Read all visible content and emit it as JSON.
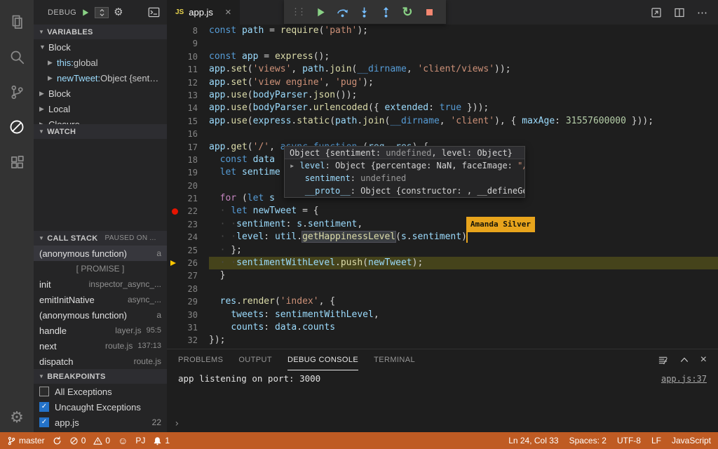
{
  "colors": {
    "status-bg": "#BF5B23",
    "flag": "#E8A41C",
    "breakpoint": "#E51400",
    "exec-line": "#45431B",
    "kw": "#569CD6",
    "ct": "#C586C0",
    "st": "#CE9178",
    "fn": "#DCDCAA",
    "vr": "#9CDCFE",
    "nm": "#B5CEA8"
  },
  "activity_bar": {
    "items": [
      {
        "name": "explorer"
      },
      {
        "name": "search"
      },
      {
        "name": "source-control"
      },
      {
        "name": "debug",
        "active": true
      },
      {
        "name": "extensions"
      }
    ]
  },
  "sidebar": {
    "toolbar": {
      "title": "DEBUG"
    },
    "variables": {
      "title": "VARIABLES",
      "rows": [
        {
          "label": "Block",
          "depth": 0,
          "expanded": true
        },
        {
          "name": "this",
          "value": "global",
          "depth": 1
        },
        {
          "name": "newTweet",
          "value": "Object {sent…",
          "depth": 1
        },
        {
          "label": "Block",
          "depth": 0
        },
        {
          "label": "Local",
          "depth": 0
        },
        {
          "label": "Closure",
          "depth": 0
        }
      ]
    },
    "watch": {
      "title": "WATCH"
    },
    "call_stack": {
      "title": "CALL STACK",
      "status": "PAUSED ON ...",
      "rows": [
        {
          "name": "(anonymous function)",
          "file": "a",
          "selected": true
        },
        {
          "separator": "[ PROMISE ]"
        },
        {
          "name": "init",
          "file": "inspector_async_..."
        },
        {
          "name": "emitInitNative",
          "file": "async_..."
        },
        {
          "name": "(anonymous function)",
          "file": "a"
        },
        {
          "name": "handle",
          "file": "layer.js",
          "pos": "95:5"
        },
        {
          "name": "next",
          "file": "route.js",
          "pos": "137:13"
        },
        {
          "name": "dispatch",
          "file": "route.js"
        }
      ]
    },
    "breakpoints": {
      "title": "BREAKPOINTS",
      "rows": [
        {
          "checked": false,
          "label": "All Exceptions"
        },
        {
          "checked": true,
          "label": "Uncaught Exceptions"
        },
        {
          "checked": true,
          "label": "app.js",
          "line": "22"
        }
      ]
    }
  },
  "tabbar": {
    "tab": {
      "icon": "JS",
      "title": "app.js"
    }
  },
  "debug_toolbar": {
    "buttons": [
      "continue",
      "step-over",
      "step-into",
      "step-out",
      "restart",
      "stop"
    ]
  },
  "editor": {
    "collaborator": "Amanda Silver",
    "tooltip": {
      "rows": [
        [
          [
            "pl",
            "Object {sentiment: "
          ],
          [
            "und",
            "undefined"
          ],
          [
            "pl",
            ", level: Object}"
          ]
        ],
        [
          [
            "tw",
            "▸ "
          ],
          [
            "vr",
            "level"
          ],
          [
            "pl",
            ": Object {percentage: NaN, faceImage: "
          ],
          [
            "st",
            "\"/a"
          ]
        ],
        [
          [
            "pl",
            "   "
          ],
          [
            "vr",
            "sentiment"
          ],
          [
            "pl",
            ": "
          ],
          [
            "und",
            "undefined"
          ]
        ],
        [
          [
            "pl",
            "   "
          ],
          [
            "vr",
            "__proto__"
          ],
          [
            "pl",
            ": Object {constructor: , __defineGette"
          ]
        ]
      ]
    },
    "lines": [
      {
        "n": 8,
        "t": [
          [
            "kw",
            "const"
          ],
          [
            "pl",
            " "
          ],
          [
            "vr",
            "path"
          ],
          [
            "pl",
            " = "
          ],
          [
            "fn",
            "require"
          ],
          [
            "pl",
            "("
          ],
          [
            "st",
            "'path'"
          ],
          [
            "pl",
            ");"
          ]
        ]
      },
      {
        "n": 9,
        "t": []
      },
      {
        "n": 10,
        "t": [
          [
            "kw",
            "const"
          ],
          [
            "pl",
            " "
          ],
          [
            "vr",
            "app"
          ],
          [
            "pl",
            " = "
          ],
          [
            "fn",
            "express"
          ],
          [
            "pl",
            "();"
          ]
        ]
      },
      {
        "n": 11,
        "t": [
          [
            "vr",
            "app"
          ],
          [
            "pl",
            "."
          ],
          [
            "fn",
            "set"
          ],
          [
            "pl",
            "("
          ],
          [
            "st",
            "'views'"
          ],
          [
            "pl",
            ", "
          ],
          [
            "vr",
            "path"
          ],
          [
            "pl",
            "."
          ],
          [
            "fn",
            "join"
          ],
          [
            "pl",
            "("
          ],
          [
            "kw",
            "__dirname"
          ],
          [
            "pl",
            ", "
          ],
          [
            "st",
            "'client/views'"
          ],
          [
            "pl",
            "));"
          ]
        ]
      },
      {
        "n": 12,
        "t": [
          [
            "vr",
            "app"
          ],
          [
            "pl",
            "."
          ],
          [
            "fn",
            "set"
          ],
          [
            "pl",
            "("
          ],
          [
            "st",
            "'view engine'"
          ],
          [
            "pl",
            ", "
          ],
          [
            "st",
            "'pug'"
          ],
          [
            "pl",
            ");"
          ]
        ]
      },
      {
        "n": 13,
        "t": [
          [
            "vr",
            "app"
          ],
          [
            "pl",
            "."
          ],
          [
            "fn",
            "use"
          ],
          [
            "pl",
            "("
          ],
          [
            "vr",
            "bodyParser"
          ],
          [
            "pl",
            "."
          ],
          [
            "fn",
            "json"
          ],
          [
            "pl",
            "());"
          ]
        ]
      },
      {
        "n": 14,
        "t": [
          [
            "vr",
            "app"
          ],
          [
            "pl",
            "."
          ],
          [
            "fn",
            "use"
          ],
          [
            "pl",
            "("
          ],
          [
            "vr",
            "bodyParser"
          ],
          [
            "pl",
            "."
          ],
          [
            "fn",
            "urlencoded"
          ],
          [
            "pl",
            "({ "
          ],
          [
            "vr",
            "extended"
          ],
          [
            "pl",
            ": "
          ],
          [
            "kw",
            "true"
          ],
          [
            "pl",
            " }));"
          ]
        ]
      },
      {
        "n": 15,
        "t": [
          [
            "vr",
            "app"
          ],
          [
            "pl",
            "."
          ],
          [
            "fn",
            "use"
          ],
          [
            "pl",
            "("
          ],
          [
            "vr",
            "express"
          ],
          [
            "pl",
            "."
          ],
          [
            "fn",
            "static"
          ],
          [
            "pl",
            "("
          ],
          [
            "vr",
            "path"
          ],
          [
            "pl",
            "."
          ],
          [
            "fn",
            "join"
          ],
          [
            "pl",
            "("
          ],
          [
            "kw",
            "__dirname"
          ],
          [
            "pl",
            ", "
          ],
          [
            "st",
            "'client'"
          ],
          [
            "pl",
            "), { "
          ],
          [
            "vr",
            "maxAge"
          ],
          [
            "pl",
            ": "
          ],
          [
            "nm",
            "31557600000"
          ],
          [
            "pl",
            " }));"
          ]
        ]
      },
      {
        "n": 16,
        "t": []
      },
      {
        "n": 17,
        "t": [
          [
            "vr",
            "app"
          ],
          [
            "pl",
            "."
          ],
          [
            "fn",
            "get"
          ],
          [
            "pl",
            "("
          ],
          [
            "st",
            "'/'"
          ],
          [
            "pl",
            ", "
          ],
          [
            "kw",
            "async"
          ],
          [
            "pl",
            " "
          ],
          [
            "kw",
            "function"
          ],
          [
            "pl",
            " ("
          ],
          [
            "vr",
            "req"
          ],
          [
            "pl",
            ", "
          ],
          [
            "vr",
            "res"
          ],
          [
            "pl",
            ") {"
          ]
        ]
      },
      {
        "n": 18,
        "t": [
          [
            "pl",
            "  "
          ],
          [
            "kw",
            "const"
          ],
          [
            "pl",
            " "
          ],
          [
            "vr",
            "data"
          ]
        ]
      },
      {
        "n": 19,
        "t": [
          [
            "pl",
            "  "
          ],
          [
            "kw",
            "let"
          ],
          [
            "pl",
            " "
          ],
          [
            "vr",
            "sentime"
          ]
        ]
      },
      {
        "n": 20,
        "t": []
      },
      {
        "n": 21,
        "t": [
          [
            "pl",
            "  "
          ],
          [
            "ct",
            "for"
          ],
          [
            "pl",
            " ("
          ],
          [
            "kw",
            "let"
          ],
          [
            "pl",
            " "
          ],
          [
            "vr",
            "s"
          ]
        ]
      },
      {
        "n": 22,
        "bp": true,
        "t": [
          [
            "ws",
            "  · "
          ],
          [
            "kw",
            "let"
          ],
          [
            "pl",
            " "
          ],
          [
            "vr",
            "newTweet"
          ],
          [
            "pl",
            " = {"
          ]
        ]
      },
      {
        "n": 23,
        "t": [
          [
            "ws",
            "  · ·"
          ],
          [
            "vr",
            "sentiment"
          ],
          [
            "pl",
            ": "
          ],
          [
            "vr",
            "s"
          ],
          [
            "pl",
            "."
          ],
          [
            "vr",
            "sentiment"
          ],
          [
            "pl",
            ","
          ]
        ]
      },
      {
        "n": 24,
        "t": [
          [
            "ws",
            "  · ·"
          ],
          [
            "vr",
            "level"
          ],
          [
            "pl",
            ": "
          ],
          [
            "vr",
            "util"
          ],
          [
            "pl",
            "."
          ],
          [
            "hl",
            "getHappinessLevel"
          ],
          [
            "pl",
            "("
          ],
          [
            "vr",
            "s"
          ],
          [
            "pl",
            "."
          ],
          [
            "vr",
            "sentiment"
          ],
          [
            "pl",
            ")"
          ],
          [
            "cur",
            ""
          ]
        ]
      },
      {
        "n": 25,
        "t": [
          [
            "ws",
            "  · "
          ],
          [
            "pl",
            "};"
          ]
        ]
      },
      {
        "n": 26,
        "exec": true,
        "t": [
          [
            "ws",
            "  · ·"
          ],
          [
            "vr",
            "sentimentWithLevel"
          ],
          [
            "pl",
            "."
          ],
          [
            "fn",
            "push"
          ],
          [
            "pl",
            "("
          ],
          [
            "vr",
            "newTweet"
          ],
          [
            "pl",
            ");"
          ]
        ]
      },
      {
        "n": 27,
        "t": [
          [
            "pl",
            "  }"
          ]
        ]
      },
      {
        "n": 28,
        "t": []
      },
      {
        "n": 29,
        "t": [
          [
            "pl",
            "  "
          ],
          [
            "vr",
            "res"
          ],
          [
            "pl",
            "."
          ],
          [
            "fn",
            "render"
          ],
          [
            "pl",
            "("
          ],
          [
            "st",
            "'index'"
          ],
          [
            "pl",
            ", {"
          ]
        ]
      },
      {
        "n": 30,
        "t": [
          [
            "pl",
            "    "
          ],
          [
            "vr",
            "tweets"
          ],
          [
            "pl",
            ": "
          ],
          [
            "vr",
            "sentimentWithLevel"
          ],
          [
            "pl",
            ","
          ]
        ]
      },
      {
        "n": 31,
        "t": [
          [
            "pl",
            "    "
          ],
          [
            "vr",
            "counts"
          ],
          [
            "pl",
            ": "
          ],
          [
            "vr",
            "data"
          ],
          [
            "pl",
            "."
          ],
          [
            "vr",
            "counts"
          ]
        ]
      },
      {
        "n": 32,
        "t": [
          [
            "pl",
            "});"
          ]
        ]
      }
    ]
  },
  "panel": {
    "tabs": [
      {
        "label": "PROBLEMS"
      },
      {
        "label": "OUTPUT"
      },
      {
        "label": "DEBUG CONSOLE",
        "active": true
      },
      {
        "label": "TERMINAL"
      }
    ],
    "console_line": {
      "text": "app listening on port: 3000",
      "source": "app.js:37"
    },
    "prompt": "›"
  },
  "statusbar": {
    "left": [
      {
        "name": "git-branch",
        "icon": "branch",
        "label": "master"
      },
      {
        "name": "sync",
        "icon": "sync"
      },
      {
        "name": "errors",
        "icon": "error",
        "label": "0"
      },
      {
        "name": "warnings",
        "icon": "warning",
        "label": "0"
      },
      {
        "name": "feedback-smiley",
        "icon": "smiley"
      },
      {
        "name": "live-share-user",
        "label": "PJ"
      },
      {
        "name": "notifications",
        "icon": "bell",
        "label": "1"
      }
    ],
    "right": [
      {
        "name": "cursor-position",
        "label": "Ln 24, Col 33"
      },
      {
        "name": "indentation",
        "label": "Spaces: 2"
      },
      {
        "name": "encoding",
        "label": "UTF-8"
      },
      {
        "name": "eol",
        "label": "LF"
      },
      {
        "name": "language-mode",
        "label": "JavaScript"
      }
    ]
  }
}
